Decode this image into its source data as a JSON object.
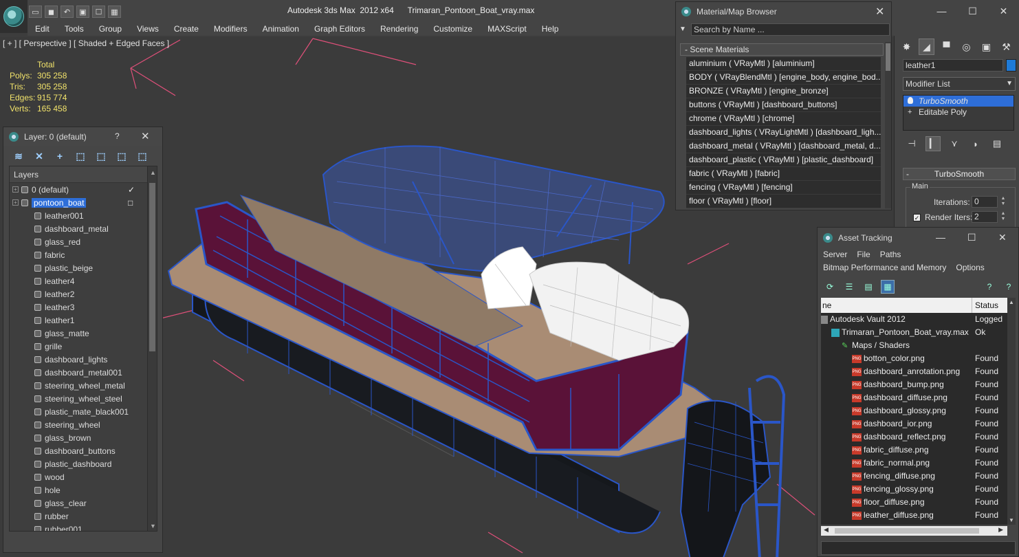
{
  "title": {
    "app": "Autodesk 3ds Max  2012 x64",
    "file": "Trimaran_Pontoon_Boat_vray.max",
    "window_controls": [
      "—",
      "☐",
      "✕"
    ]
  },
  "quick_access": [
    "▭",
    "◼",
    "↶",
    "▣",
    "☐",
    "▦"
  ],
  "menu": [
    "Edit",
    "Tools",
    "Group",
    "Views",
    "Create",
    "Modifiers",
    "Animation",
    "Graph Editors",
    "Rendering",
    "Customize",
    "MAXScript",
    "Help"
  ],
  "viewport": {
    "label": "[ + ] [ Perspective ] [ Shaded + Edged Faces ]",
    "stats": {
      "header": "Total",
      "rows": [
        {
          "label": "Polys:",
          "value": "305 258"
        },
        {
          "label": "Tris:",
          "value": "305 258"
        },
        {
          "label": "Edges:",
          "value": "915 774"
        },
        {
          "label": "Verts:",
          "value": "165 458"
        }
      ]
    }
  },
  "layer_panel": {
    "title": "Layer: 0 (default)",
    "help": "?",
    "close": "✕",
    "column_header": "Layers",
    "tools": [
      "≋",
      "✕",
      "+",
      "⬚",
      "⬚",
      "⬚",
      "⬚"
    ],
    "rows": [
      {
        "label": "0 (default)",
        "kind": "layer",
        "marker": "✓"
      },
      {
        "label": "pontoon_boat",
        "kind": "layer",
        "marker": "□",
        "selected": true
      },
      {
        "label": "leather001",
        "kind": "object"
      },
      {
        "label": "dashboard_metal",
        "kind": "object"
      },
      {
        "label": "glass_red",
        "kind": "object"
      },
      {
        "label": "fabric",
        "kind": "object"
      },
      {
        "label": "plastic_beige",
        "kind": "object"
      },
      {
        "label": "leather4",
        "kind": "object"
      },
      {
        "label": "leather2",
        "kind": "object"
      },
      {
        "label": "leather3",
        "kind": "object"
      },
      {
        "label": "leather1",
        "kind": "object"
      },
      {
        "label": "glass_matte",
        "kind": "object"
      },
      {
        "label": "grille",
        "kind": "object"
      },
      {
        "label": "dashboard_lights",
        "kind": "object"
      },
      {
        "label": "dashboard_metal001",
        "kind": "object"
      },
      {
        "label": "steering_wheel_metal",
        "kind": "object"
      },
      {
        "label": "steering_wheel_steel",
        "kind": "object"
      },
      {
        "label": "plastic_mate_black001",
        "kind": "object"
      },
      {
        "label": "steering_wheel",
        "kind": "object"
      },
      {
        "label": "glass_brown",
        "kind": "object"
      },
      {
        "label": "dashboard_buttons",
        "kind": "object"
      },
      {
        "label": "plastic_dashboard",
        "kind": "object"
      },
      {
        "label": "wood",
        "kind": "object"
      },
      {
        "label": "hole",
        "kind": "object"
      },
      {
        "label": "glass_clear",
        "kind": "object"
      },
      {
        "label": "rubber",
        "kind": "object"
      },
      {
        "label": "rubber001",
        "kind": "object"
      }
    ]
  },
  "material_browser": {
    "title": "Material/Map Browser",
    "close": "✕",
    "search_placeholder": "Search by Name ...",
    "group": "- Scene Materials",
    "items": [
      "aluminium  ( VRayMtl )  [aluminium]",
      "BODY  ( VRayBlendMtl )  [engine_body, engine_bod...",
      "BRONZE  ( VRayMtl )  [engine_bronze]",
      "buttons  ( VRayMtl )  [dashboard_buttons]",
      "chrome  ( VRayMtl )  [chrome]",
      "dashboard_lights  ( VRayLightMtl )  [dashboard_ligh...",
      "dashboard_metal  ( VRayMtl )  [dashboard_metal, d...",
      "dashboard_plastic  ( VRayMtl )  [plastic_dashboard]",
      "fabric  ( VRayMtl )  [fabric]",
      "fencing  ( VRayMtl )  [fencing]",
      "floor  ( VRayMtl )  [floor]"
    ]
  },
  "command_panel": {
    "tabs": [
      "✸",
      "◢",
      "▀",
      "◎",
      "▣",
      "⚒"
    ],
    "object_name": "leather1",
    "object_color": "#1f7bd8",
    "modifier_list_label": "Modifier List",
    "stack": [
      {
        "label": "TurboSmooth",
        "selected": true
      },
      {
        "label": "Editable Poly",
        "selected": false
      }
    ],
    "stack_tools": [
      "⊣",
      "▎",
      "⋎",
      "◗",
      "▤"
    ],
    "rollout": {
      "title": "TurboSmooth",
      "collapse": "-",
      "group": "Main",
      "iterations_label": "Iterations:",
      "iterations_value": "0",
      "render_iters_label": "Render Iters:",
      "render_iters_value": "2",
      "render_iters_checked": true
    }
  },
  "asset_tracking": {
    "title": "Asset Tracking",
    "menu_row1": [
      "Server",
      "File",
      "Paths"
    ],
    "menu_row2": [
      "Bitmap Performance and Memory",
      "Options"
    ],
    "columns": [
      "ne",
      "Status"
    ],
    "rows": [
      {
        "name": "Autodesk Vault 2012",
        "status": "Logged",
        "indent": 0,
        "icon": "vault"
      },
      {
        "name": "Trimaran_Pontoon_Boat_vray.max",
        "status": "Ok",
        "indent": 1,
        "icon": "max"
      },
      {
        "name": "Maps / Shaders",
        "status": "",
        "indent": 2,
        "icon": "maps"
      },
      {
        "name": "botton_color.png",
        "status": "Found",
        "indent": 3,
        "icon": "png"
      },
      {
        "name": "dashboard_anrotation.png",
        "status": "Found",
        "indent": 3,
        "icon": "png"
      },
      {
        "name": "dashboard_bump.png",
        "status": "Found",
        "indent": 3,
        "icon": "png"
      },
      {
        "name": "dashboard_diffuse.png",
        "status": "Found",
        "indent": 3,
        "icon": "png"
      },
      {
        "name": "dashboard_glossy.png",
        "status": "Found",
        "indent": 3,
        "icon": "png"
      },
      {
        "name": "dashboard_ior.png",
        "status": "Found",
        "indent": 3,
        "icon": "png"
      },
      {
        "name": "dashboard_reflect.png",
        "status": "Found",
        "indent": 3,
        "icon": "png"
      },
      {
        "name": "fabric_diffuse.png",
        "status": "Found",
        "indent": 3,
        "icon": "png"
      },
      {
        "name": "fabric_normal.png",
        "status": "Found",
        "indent": 3,
        "icon": "png"
      },
      {
        "name": "fencing_diffuse.png",
        "status": "Found",
        "indent": 3,
        "icon": "png"
      },
      {
        "name": "fencing_glossy.png",
        "status": "Found",
        "indent": 3,
        "icon": "png"
      },
      {
        "name": "floor_diffuse.png",
        "status": "Found",
        "indent": 3,
        "icon": "png"
      },
      {
        "name": "leather_diffuse.png",
        "status": "Found",
        "indent": 3,
        "icon": "png"
      }
    ]
  }
}
